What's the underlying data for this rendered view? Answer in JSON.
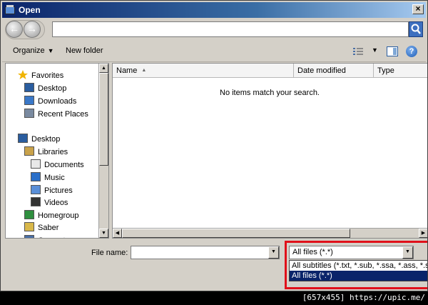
{
  "window": {
    "title": "Open"
  },
  "address": {
    "value": ""
  },
  "toolbar": {
    "organize": "Organize",
    "new_folder": "New folder"
  },
  "nav": {
    "items": [
      {
        "label": "Favorites",
        "icon": "star-icon"
      },
      {
        "label": "Desktop",
        "icon": "desktop-icon"
      },
      {
        "label": "Downloads",
        "icon": "downloads-icon"
      },
      {
        "label": "Recent Places",
        "icon": "recent-places-icon"
      },
      {
        "label": "Desktop",
        "icon": "desktop-icon"
      },
      {
        "label": "Libraries",
        "icon": "libraries-icon"
      },
      {
        "label": "Documents",
        "icon": "documents-icon"
      },
      {
        "label": "Music",
        "icon": "music-icon"
      },
      {
        "label": "Pictures",
        "icon": "pictures-icon"
      },
      {
        "label": "Videos",
        "icon": "videos-icon"
      },
      {
        "label": "Homegroup",
        "icon": "homegroup-icon"
      },
      {
        "label": "Saber",
        "icon": "user-folder-icon"
      },
      {
        "label": "Computer",
        "icon": "computer-icon"
      }
    ]
  },
  "files": {
    "columns": {
      "name": "Name",
      "date_modified": "Date modified",
      "type": "Type"
    },
    "empty_message": "No items match your search."
  },
  "filename": {
    "label": "File name:",
    "value": ""
  },
  "filetype": {
    "selected": "All files (*.*)",
    "options": [
      "All subtitles (*.txt, *.sub, *.ssa, *.ass, *.smi",
      "All files (*.*)"
    ]
  },
  "caption": "[657x455] https://upic.me/",
  "colors": {
    "accent": "#0a246a",
    "highlight_border": "#e0101a",
    "face": "#d4d0c8"
  }
}
